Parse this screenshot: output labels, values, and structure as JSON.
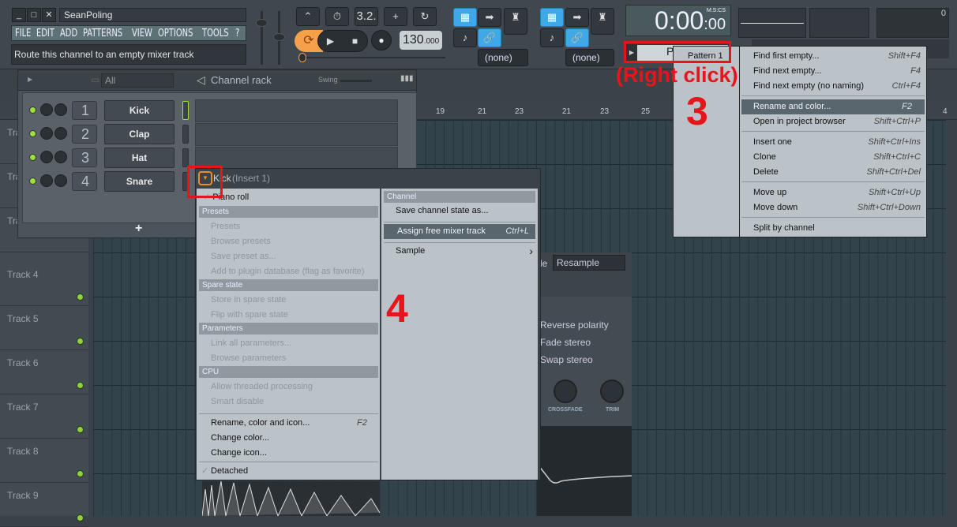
{
  "window": {
    "title": "SeanPoling",
    "minimize": "_",
    "maximize": "□",
    "close": "✕"
  },
  "menu": [
    "FILE",
    "EDIT",
    "ADD",
    "PATTERNS",
    "VIEW",
    "OPTIONS",
    "TOOLS",
    "?"
  ],
  "hint": "Route this channel to an empty mixer track",
  "transport": {
    "tempo": "130",
    "tempo_decimals": ".000",
    "time": "0:00",
    "time_cs": "00",
    "time_format": "M:S:CS",
    "step_label": "3.2.",
    "none1": "(none)",
    "none2": "(none)",
    "meter_value": "0"
  },
  "channel_rack": {
    "filter": "All",
    "title": "Channel rack",
    "swing_label": "Swing",
    "add": "+",
    "channels": [
      {
        "num": "1",
        "name": "Kick"
      },
      {
        "num": "2",
        "name": "Clap"
      },
      {
        "num": "3",
        "name": "Hat"
      },
      {
        "num": "4",
        "name": "Snare"
      }
    ]
  },
  "playlist": {
    "ruler": [
      "19",
      "21",
      "23",
      "21",
      "23",
      "25",
      "4"
    ],
    "tracks": [
      "Track 4",
      "Track 5",
      "Track 6",
      "Track 7",
      "Track 8",
      "Track 9"
    ],
    "partial_tracks": [
      "Tra",
      "Tra",
      "Tra"
    ]
  },
  "plugin": {
    "title": "Kick",
    "subtitle": "(Insert 1)",
    "left_menu": {
      "piano_roll": "Piano roll",
      "sections": [
        {
          "header": "Presets",
          "items": [
            "Presets",
            "Browse presets",
            "Save preset as...",
            "Add to plugin database (flag as favorite)"
          ]
        },
        {
          "header": "Spare state",
          "items": [
            "Store in spare state",
            "Flip with spare state"
          ]
        },
        {
          "header": "Parameters",
          "items": [
            "Link all parameters...",
            "Browse parameters"
          ]
        },
        {
          "header": "CPU",
          "items": [
            "Allow threaded processing",
            "Smart disable"
          ]
        }
      ],
      "rename": "Rename, color and icon...",
      "rename_shortcut": "F2",
      "change_color": "Change color...",
      "change_icon": "Change icon...",
      "detached": "Detached",
      "check": "✓"
    },
    "right_menu": {
      "header": "Channel",
      "save_state": "Save channel state as...",
      "assign": "Assign free mixer track",
      "assign_shortcut": "Ctrl+L",
      "sample": "Sample",
      "arrow": "›"
    }
  },
  "channel_settings": {
    "mode_partial": "de",
    "resample": "Resample",
    "options": [
      "Reverse polarity",
      "Fade stereo",
      "Swap stereo"
    ],
    "knobs": [
      "CROSSFADE",
      "TRIM"
    ]
  },
  "pattern": {
    "label_partial": "P",
    "name": "Pattern 1",
    "items": [
      {
        "label": "Find first empty...",
        "shortcut": "Shift+F4"
      },
      {
        "label": "Find next empty...",
        "shortcut": "F4"
      },
      {
        "label": "Find next empty (no naming)",
        "shortcut": "Ctrl+F4"
      },
      {
        "label": "Rename and color...",
        "shortcut": "F2",
        "highlight": true
      },
      {
        "label": "Open in project browser",
        "shortcut": "Shift+Ctrl+P"
      },
      {
        "label": "Insert one",
        "shortcut": "Shift+Ctrl+Ins"
      },
      {
        "label": "Clone",
        "shortcut": "Shift+Ctrl+C"
      },
      {
        "label": "Delete",
        "shortcut": "Shift+Ctrl+Del"
      },
      {
        "label": "Move up",
        "shortcut": "Shift+Ctrl+Up"
      },
      {
        "label": "Move down",
        "shortcut": "Shift+Ctrl+Down"
      },
      {
        "label": "Split by channel",
        "shortcut": ""
      }
    ]
  },
  "annotations": {
    "right_click": "(Right click)",
    "step3": "3",
    "step4": "4"
  },
  "colors": {
    "annotation": "#e8141c",
    "accent_blue": "#3ea8e8",
    "loop_orange": "#f5a04a",
    "led_green": "#9be03c"
  }
}
